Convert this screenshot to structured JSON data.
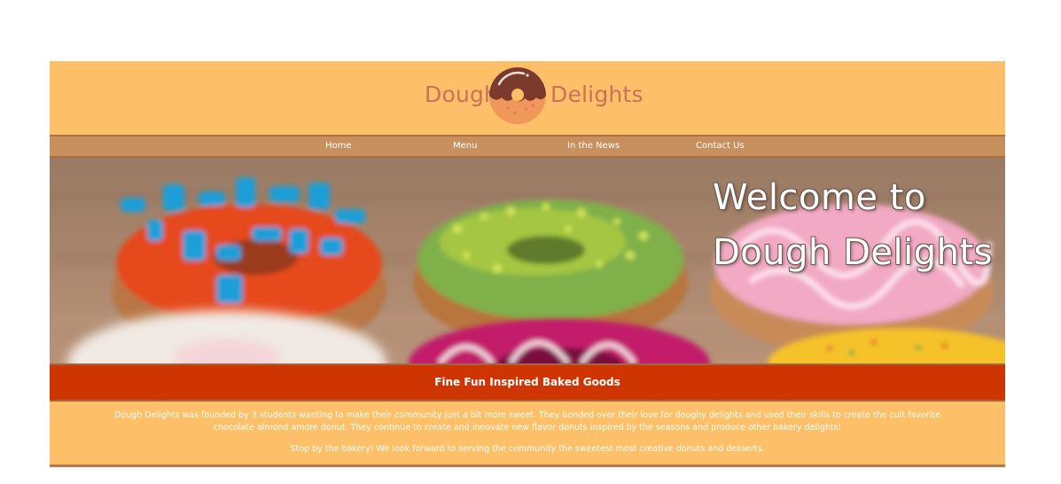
{
  "brand": {
    "name_left": "Dough",
    "name_right": "Delights",
    "logo_icon": "donut-icon",
    "text_color": "#c8715b"
  },
  "nav": {
    "items": [
      {
        "label": "Home"
      },
      {
        "label": "Menu"
      },
      {
        "label": "In the News"
      },
      {
        "label": "Contact Us"
      }
    ]
  },
  "hero": {
    "title_line1": "Welcome to",
    "title_line2": "Dough Delights",
    "image": "blurred-donuts-photo"
  },
  "tagline": "Fine Fun Inspired Baked Goods",
  "about": {
    "paragraph1": "Dough Delights was founded by 3 students wanting to make their community just a bit more sweet. They bonded over their love for doughy delights and used their skills to create the cult favorite chocolate almond amore donut. They continue to create and innovate new flavor donuts inspired by the seasons and produce other bakery delights!",
    "paragraph2": "Stop by the bakery! We look forward to serving the community the sweetest most creative donuts and desserts."
  },
  "colors": {
    "page_background": "#ffffff",
    "header_background": "#fdc068",
    "nav_background": "#c8905e",
    "tagline_background": "#cf3503",
    "text_light": "#ffffff"
  }
}
